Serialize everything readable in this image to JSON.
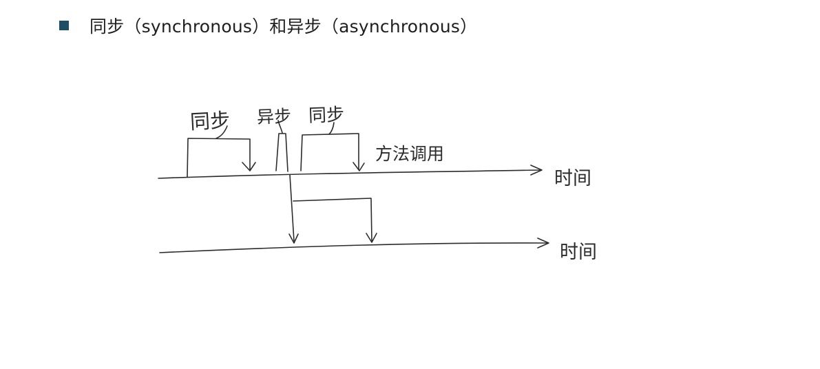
{
  "heading": {
    "bullet_color": "#1c4f63",
    "text": "同步（synchronous）和异步（asynchronous）"
  },
  "diagram": {
    "labels": {
      "sync_left": "同步",
      "async": "异步",
      "sync_right": "同步",
      "method_call": "方法调用",
      "time_top": "时间",
      "time_bottom": "时间"
    },
    "ink_color": "#2b2b2b"
  }
}
